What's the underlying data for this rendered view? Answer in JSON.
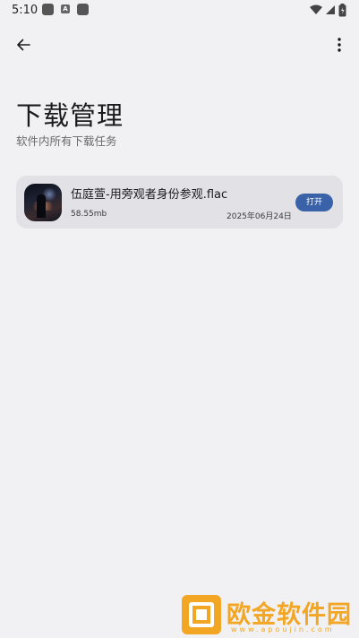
{
  "status_bar": {
    "time": "5:10",
    "notif_a": "A"
  },
  "page": {
    "title": "下载管理",
    "subtitle": "软件内所有下载任务"
  },
  "downloads": [
    {
      "file_name": "伍庭萱-用旁观者身份参观.flac",
      "size": "58.55mb",
      "date": "2025年06月24日",
      "action_label": "打开"
    }
  ],
  "watermark": {
    "text": "欧金软件园",
    "url": "www.apoujin.com"
  },
  "colors": {
    "background": "#f1f1f3",
    "card": "#e2e2e6",
    "accent": "#3a62a8",
    "watermark": "#f2a623"
  },
  "icons": {
    "back": "arrow-left-icon",
    "more": "more-vertical-icon"
  }
}
